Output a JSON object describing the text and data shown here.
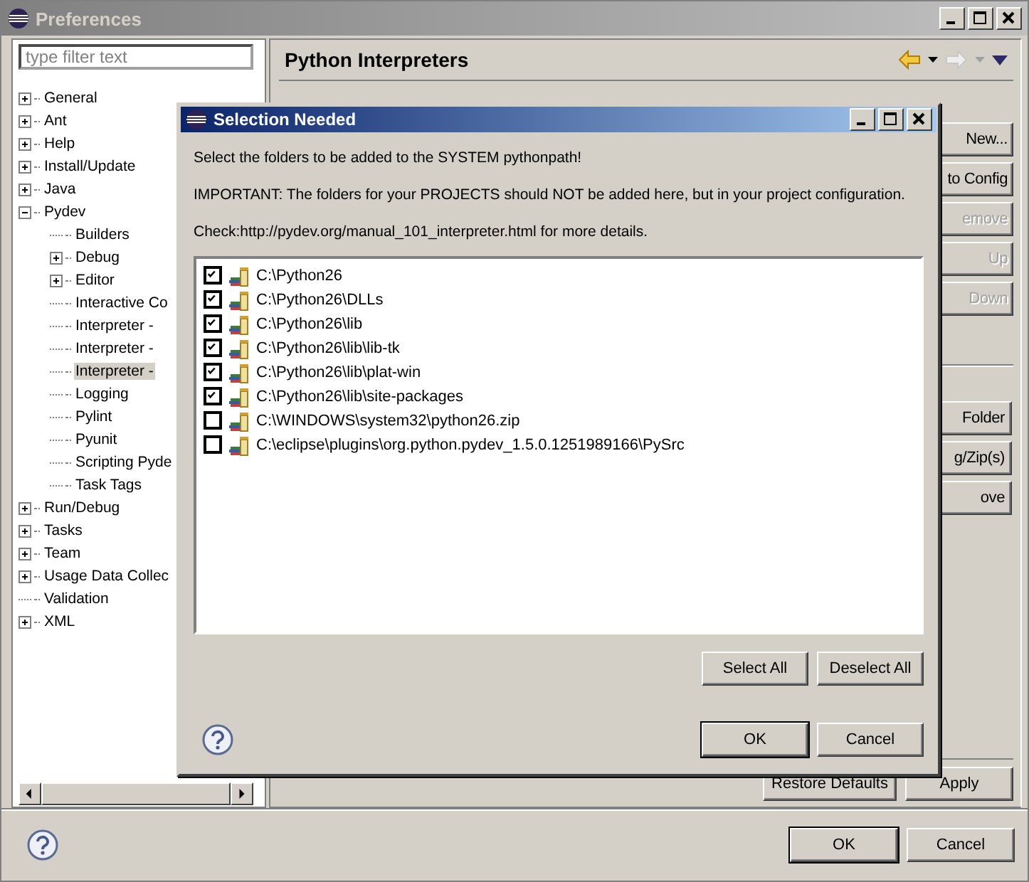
{
  "window": {
    "title": "Preferences"
  },
  "filter": {
    "placeholder": "type filter text"
  },
  "tree": [
    {
      "label": "General",
      "kind": "group",
      "expanded": false,
      "selected": false
    },
    {
      "label": "Ant",
      "kind": "group",
      "expanded": false,
      "selected": false
    },
    {
      "label": "Help",
      "kind": "group",
      "expanded": false,
      "selected": false
    },
    {
      "label": "Install/Update",
      "kind": "group",
      "expanded": false,
      "selected": false
    },
    {
      "label": "Java",
      "kind": "group",
      "expanded": false,
      "selected": false
    },
    {
      "label": "Pydev",
      "kind": "group",
      "expanded": true,
      "selected": false,
      "children": [
        {
          "label": "Builders",
          "kind": "page",
          "selected": false
        },
        {
          "label": "Debug",
          "kind": "group",
          "expanded": false,
          "selected": false
        },
        {
          "label": "Editor",
          "kind": "group",
          "expanded": false,
          "selected": false
        },
        {
          "label": "Interactive Co",
          "kind": "page",
          "selected": false
        },
        {
          "label": "Interpreter -",
          "kind": "page",
          "selected": false
        },
        {
          "label": "Interpreter -",
          "kind": "page",
          "selected": false
        },
        {
          "label": "Interpreter -",
          "kind": "page",
          "selected": true
        },
        {
          "label": "Logging",
          "kind": "page",
          "selected": false
        },
        {
          "label": "Pylint",
          "kind": "page",
          "selected": false
        },
        {
          "label": "Pyunit",
          "kind": "page",
          "selected": false
        },
        {
          "label": "Scripting Pyde",
          "kind": "page",
          "selected": false
        },
        {
          "label": "Task Tags",
          "kind": "page",
          "selected": false
        }
      ]
    },
    {
      "label": "Run/Debug",
      "kind": "group",
      "expanded": false,
      "selected": false
    },
    {
      "label": "Tasks",
      "kind": "group",
      "expanded": false,
      "selected": false
    },
    {
      "label": "Team",
      "kind": "group",
      "expanded": false,
      "selected": false
    },
    {
      "label": "Usage Data Collec",
      "kind": "group",
      "expanded": false,
      "selected": false
    },
    {
      "label": "Validation",
      "kind": "page",
      "selected": false
    },
    {
      "label": "XML",
      "kind": "group",
      "expanded": false,
      "selected": false
    }
  ],
  "page": {
    "title": "Python Interpreters",
    "buttons": [
      {
        "label": "New...",
        "disabled": false
      },
      {
        "label": "to Config",
        "disabled": false
      },
      {
        "label": "emove",
        "disabled": true
      },
      {
        "label": "Up",
        "disabled": true
      },
      {
        "label": "Down",
        "disabled": true
      }
    ],
    "group_buttons": [
      {
        "label": "Folder",
        "disabled": false
      },
      {
        "label": "g/Zip(s)",
        "disabled": false
      },
      {
        "label": "ove",
        "disabled": false
      }
    ],
    "restore_defaults": "Restore Defaults",
    "apply": "Apply"
  },
  "footer": {
    "ok": "OK",
    "cancel": "Cancel"
  },
  "dialog": {
    "title": "Selection Needed",
    "messages": [
      "Select the folders to be added to the SYSTEM pythonpath!",
      "IMPORTANT: The folders for your PROJECTS should NOT be added here, but in your project configuration.",
      "Check:http://pydev.org/manual_101_interpreter.html for more details."
    ],
    "entries": [
      {
        "path": "C:\\Python26",
        "checked": true
      },
      {
        "path": "C:\\Python26\\DLLs",
        "checked": true
      },
      {
        "path": "C:\\Python26\\lib",
        "checked": true
      },
      {
        "path": "C:\\Python26\\lib\\lib-tk",
        "checked": true
      },
      {
        "path": "C:\\Python26\\lib\\plat-win",
        "checked": true
      },
      {
        "path": "C:\\Python26\\lib\\site-packages",
        "checked": true
      },
      {
        "path": "C:\\WINDOWS\\system32\\python26.zip",
        "checked": false
      },
      {
        "path": "C:\\eclipse\\plugins\\org.python.pydev_1.5.0.1251989166\\PySrc",
        "checked": false
      }
    ],
    "select_all": "Select All",
    "deselect_all": "Deselect All",
    "ok": "OK",
    "cancel": "Cancel"
  }
}
